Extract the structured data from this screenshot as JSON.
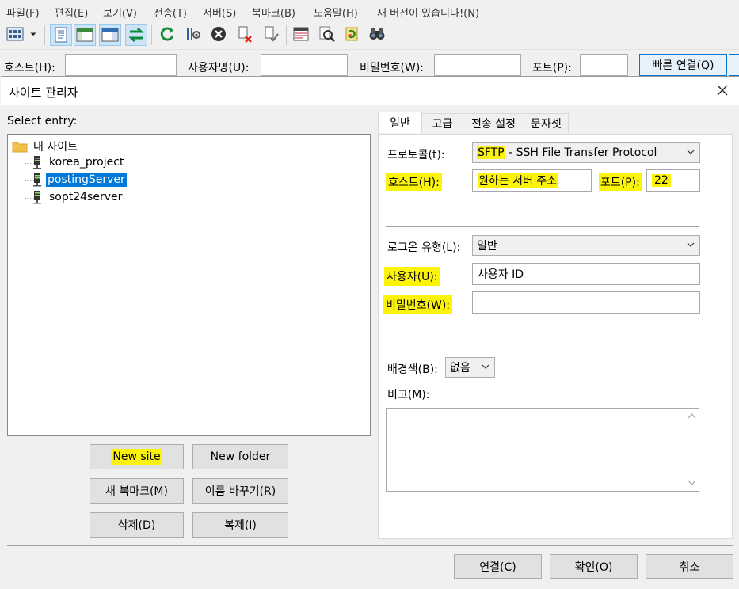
{
  "menu": [
    "파일(F)",
    "편집(E)",
    "보기(V)",
    "전송(T)",
    "서버(S)",
    "북마크(B)",
    "도움말(H)",
    "새 버전이 있습니다!(N)"
  ],
  "toolbar": {
    "icons": [
      "site-manager-icon",
      "dropdown-arrow-icon",
      "message-log-icon",
      "local-tree-icon",
      "remote-tree-icon",
      "transfer-queue-icon",
      "refresh-icon",
      "process-queue-icon",
      "cancel-icon",
      "disconnect-icon",
      "reconnect-icon",
      "directory-listing-filters-icon",
      "compare-icon",
      "sync-browse-icon",
      "search-icon"
    ]
  },
  "quickconnect": {
    "host_label": "호스트(H):",
    "user_label": "사용자명(U):",
    "pass_label": "비밀번호(W):",
    "port_label": "포트(P):",
    "connect_label": "빠른 연결(Q)"
  },
  "dialog": {
    "title": "사이트 관리자",
    "select_entry": "Select entry:",
    "tree": {
      "root": "내 사이트",
      "sites": [
        "korea_project",
        "postingServer",
        "sopt24server"
      ],
      "selected": "postingServer"
    },
    "buttons": {
      "new_site": "New site",
      "new_folder": "New folder",
      "new_bookmark": "새 북마크(M)",
      "rename": "이름 바꾸기(R)",
      "delete": "삭제(D)",
      "duplicate": "복제(I)"
    },
    "tabs": [
      "일반",
      "고급",
      "전송 설정",
      "문자셋"
    ],
    "general": {
      "protocol_label": "프로토콜(t):",
      "protocol_value_a": "SFTP",
      "protocol_value_b": " - SSH File Transfer Protocol",
      "host_label": "호스트(H):",
      "host_value": "원하는 서버 주소",
      "port_label": "포트(P):",
      "port_value": "22",
      "logon_label": "로그온 유형(L):",
      "logon_value": "일반",
      "user_label": "사용자(U):",
      "user_value": "사용자 ID",
      "pass_label": "비밀번호(W):",
      "pass_value": "",
      "bgcolor_label": "배경색(B):",
      "bgcolor_value": "없음",
      "comments_label": "비고(M):"
    },
    "footer": {
      "connect": "연결(C)",
      "ok": "확인(O)",
      "cancel": "취소"
    }
  },
  "colors": {
    "highlight": "#fbf40a",
    "selection": "#0078d7",
    "accent_border": "#0078d7"
  }
}
